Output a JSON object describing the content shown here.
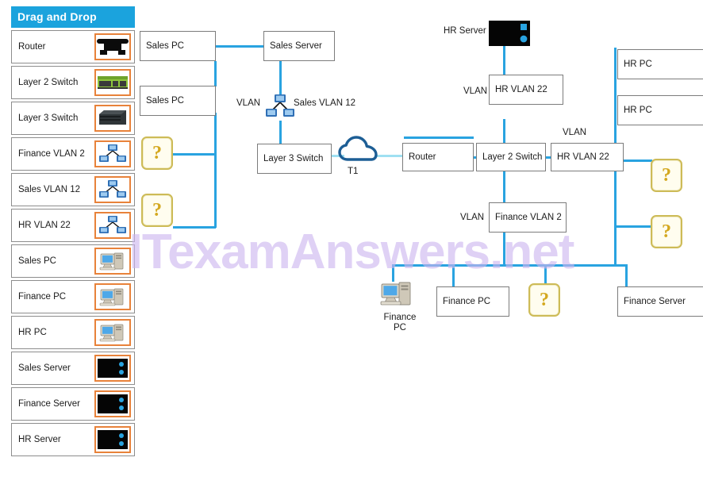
{
  "sidebar": {
    "header": "Drag and Drop",
    "items": [
      {
        "label": "Router",
        "icon": "router-icon"
      },
      {
        "label": "Layer 2 Switch",
        "icon": "layer2-switch-icon"
      },
      {
        "label": "Layer 3 Switch",
        "icon": "layer3-switch-icon"
      },
      {
        "label": "Finance VLAN 2",
        "icon": "vlan-cluster-icon"
      },
      {
        "label": "Sales VLAN 12",
        "icon": "vlan-cluster-icon"
      },
      {
        "label": "HR VLAN 22",
        "icon": "vlan-cluster-icon"
      },
      {
        "label": "Sales PC",
        "icon": "desktop-pc-icon"
      },
      {
        "label": "Finance PC",
        "icon": "desktop-pc-icon"
      },
      {
        "label": "HR PC",
        "icon": "desktop-pc-icon"
      },
      {
        "label": "Sales Server",
        "icon": "server-icon"
      },
      {
        "label": "Finance Server",
        "icon": "server-icon"
      },
      {
        "label": "HR Server",
        "icon": "server-icon"
      }
    ]
  },
  "diagram": {
    "nodes": [
      {
        "id": "sales_pc_1",
        "label": "Sales PC"
      },
      {
        "id": "sales_pc_2",
        "label": "Sales PC"
      },
      {
        "id": "sales_server",
        "label": "Sales Server"
      },
      {
        "id": "layer3_switch",
        "label": "Layer 3 Switch"
      },
      {
        "id": "router",
        "label": "Router"
      },
      {
        "id": "layer2_switch",
        "label": "Layer 2 Switch"
      },
      {
        "id": "hr_vlan_22_top",
        "label": "HR VLAN 22"
      },
      {
        "id": "hr_vlan_22_mid",
        "label": "HR VLAN 22"
      },
      {
        "id": "finance_vlan_2",
        "label": "Finance VLAN 2"
      },
      {
        "id": "hr_pc_1",
        "label": "HR PC"
      },
      {
        "id": "hr_pc_2",
        "label": "HR PC"
      },
      {
        "id": "finance_pc",
        "label": "Finance PC"
      },
      {
        "id": "finance_server",
        "label": "Finance Server"
      }
    ],
    "vlan_tags": [
      {
        "id": "vlan_tag_sales",
        "text": "VLAN"
      },
      {
        "id": "vlan_tag_hr_top",
        "text": "VLAN"
      },
      {
        "id": "vlan_tag_hr_mid",
        "text": "VLAN"
      },
      {
        "id": "vlan_tag_finance",
        "text": "VLAN"
      }
    ],
    "free_labels": [
      {
        "id": "sales_vlan_12_label",
        "text": "Sales VLAN 12"
      },
      {
        "id": "hr_server_label",
        "text": "HR Server"
      },
      {
        "id": "t1_label",
        "text": "T1"
      },
      {
        "id": "finance_pc_label",
        "text": "Finance\nPC"
      }
    ],
    "drop_targets": [
      {
        "id": "drop_left_1",
        "text": "?"
      },
      {
        "id": "drop_left_2",
        "text": "?"
      },
      {
        "id": "drop_right_1",
        "text": "?"
      },
      {
        "id": "drop_right_2",
        "text": "?"
      },
      {
        "id": "drop_bottom_1",
        "text": "?"
      }
    ],
    "icons": [
      {
        "id": "sales_vlan_icon",
        "name": "vlan-cluster-icon"
      },
      {
        "id": "hr_server_icon",
        "name": "server-icon"
      },
      {
        "id": "cloud_icon",
        "name": "cloud-icon"
      },
      {
        "id": "finance_pc_icon",
        "name": "desktop-pc-icon"
      }
    ]
  },
  "watermark": {
    "text": "ITexamAnswers.net"
  },
  "colors": {
    "header_blue": "#1ba3dd",
    "link_blue": "#29a3e0",
    "link_pale": "#9fe0f2",
    "drop_border": "#cdbb57",
    "drop_fill": "#fffdef",
    "drop_text": "#d4a820",
    "thumb_border": "#e8823a",
    "node_border": "#7c7c7c",
    "watermark_purple": "#cdb6f0"
  }
}
